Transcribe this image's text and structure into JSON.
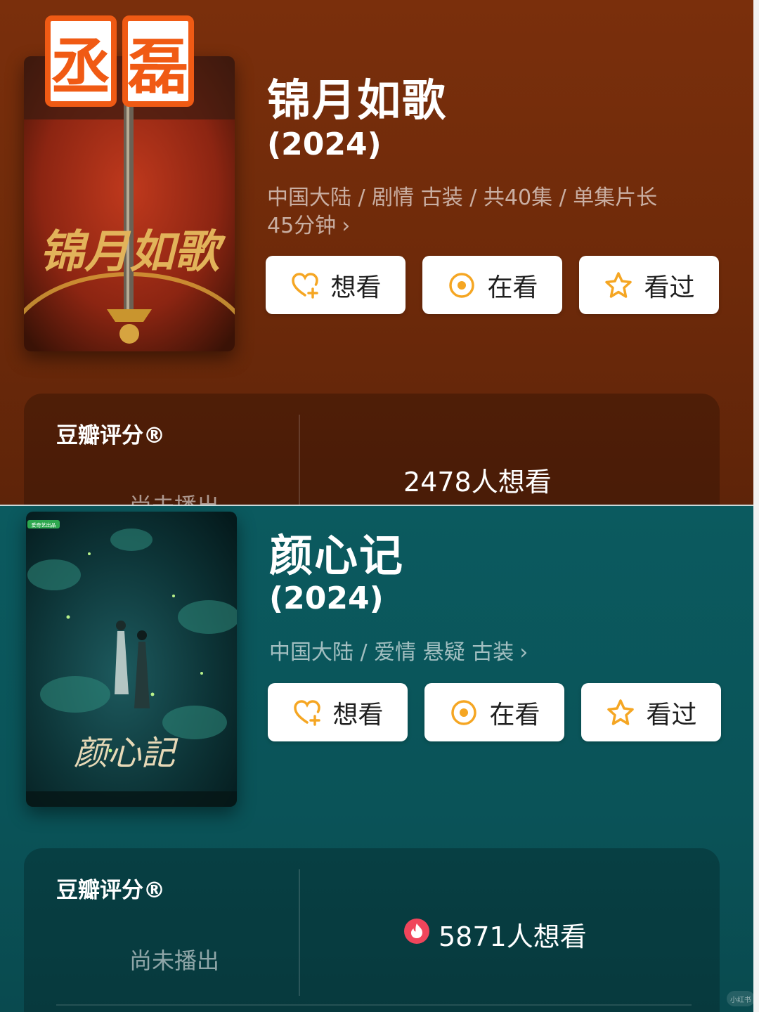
{
  "overlay": {
    "stamp_chars": [
      "丞",
      "磊"
    ]
  },
  "shows": [
    {
      "title": "锦月如歌",
      "year": "(2024)",
      "meta_line1": "中国大陆 / 剧情 古装 / 共40集 / 单集片长",
      "meta_line2": "45分钟",
      "chevron": "›",
      "buttons": {
        "want": "想看",
        "watching": "在看",
        "watched": "看过"
      },
      "rating_label": "豆瓣评分®",
      "rating_status": "尚未播出",
      "want_count": "2478人想看",
      "poster": {
        "calligraphy": "锦月如歌"
      }
    },
    {
      "title": "颜心记",
      "year": "(2024)",
      "meta_line1": "中国大陆 / 爱情 悬疑 古装",
      "chevron": "›",
      "buttons": {
        "want": "想看",
        "watching": "在看",
        "watched": "看过"
      },
      "rating_label": "豆瓣评分®",
      "rating_status": "尚未播出",
      "want_count": "5871人想看",
      "poster": {
        "calligraphy": "颜心記",
        "badge": "爱奇艺出品"
      }
    }
  ],
  "colors": {
    "accent_orange": "#f5a623",
    "stamp_orange": "#f05a14",
    "hot_red": "#f0455b"
  },
  "watermark": "小红书"
}
